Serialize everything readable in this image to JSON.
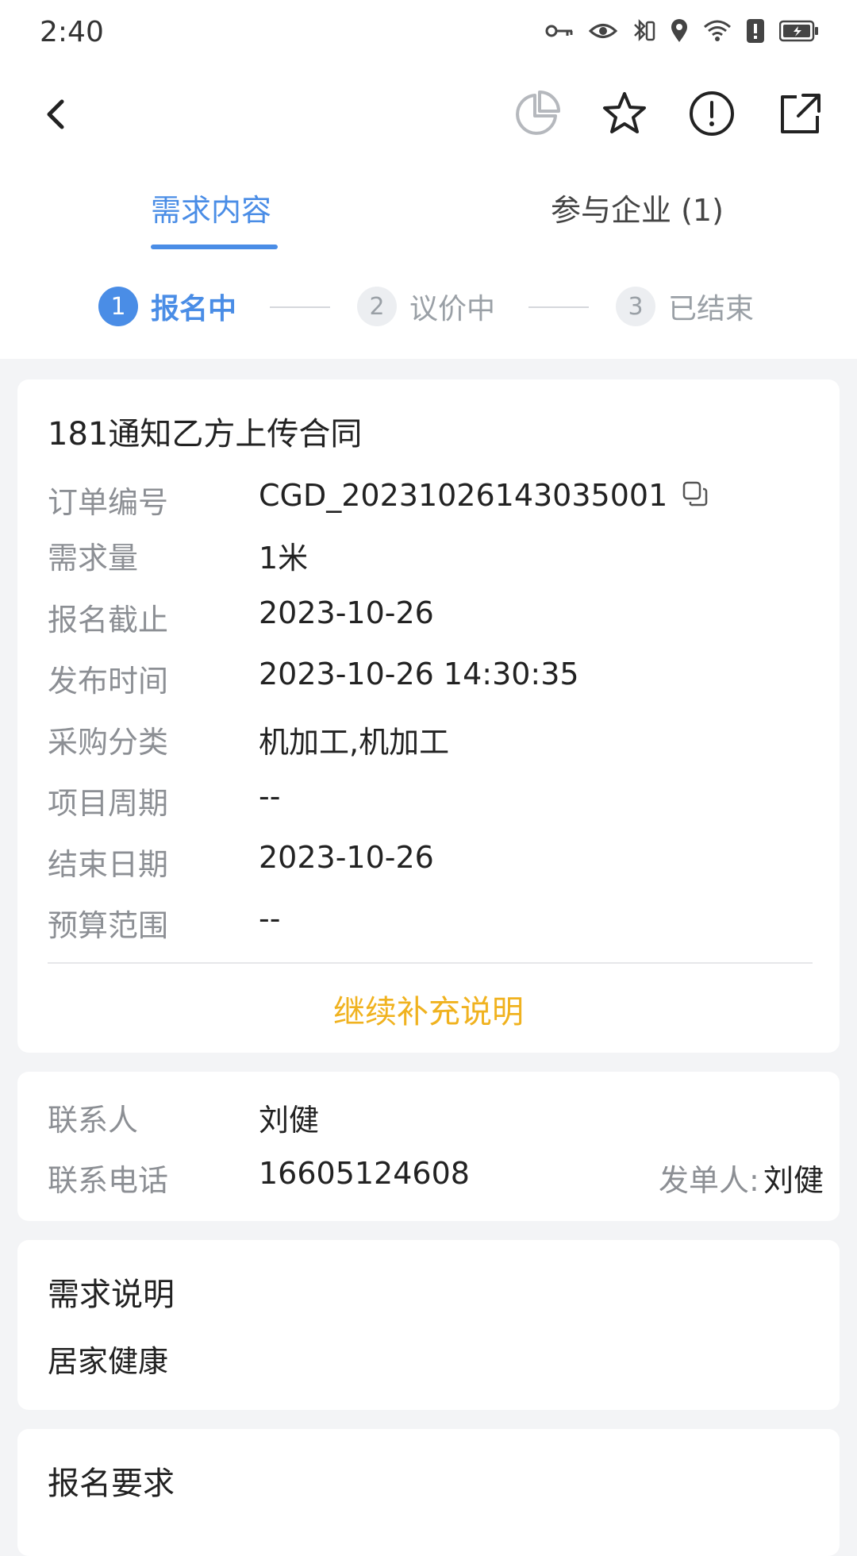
{
  "status_bar": {
    "time": "2:40",
    "icons": [
      "key-icon",
      "eye-icon",
      "bluetooth-icon",
      "location-icon",
      "wifi-icon",
      "alert-icon",
      "battery-icon"
    ]
  },
  "nav": {
    "icons": [
      "back-icon",
      "pie-chart-icon",
      "star-icon",
      "report-icon",
      "share-icon"
    ]
  },
  "tabs": [
    {
      "label": "需求内容"
    },
    {
      "label": "参与企业 (1)"
    }
  ],
  "steps": [
    {
      "num": "1",
      "label": "报名中"
    },
    {
      "num": "2",
      "label": "议价中"
    },
    {
      "num": "3",
      "label": "已结束"
    }
  ],
  "order": {
    "title": "181通知乙方上传合同",
    "rows": [
      {
        "label": "订单编号",
        "value": "CGD_20231026143035001"
      },
      {
        "label": "需求量",
        "value": "1米"
      },
      {
        "label": "报名截止",
        "value": "2023-10-26"
      },
      {
        "label": "发布时间",
        "value": "2023-10-26 14:30:35"
      },
      {
        "label": "采购分类",
        "value": "机加工,机加工"
      },
      {
        "label": "项目周期",
        "value": "--"
      },
      {
        "label": "结束日期",
        "value": "2023-10-26"
      },
      {
        "label": "预算范围",
        "value": "--"
      }
    ],
    "supplement_label": "继续补充说明"
  },
  "contact": {
    "contact_label": "联系人",
    "contact_value": "刘健",
    "phone_label": "联系电话",
    "phone_value": "16605124608",
    "issuer_label": "发单人:",
    "issuer_value": "刘健"
  },
  "description": {
    "title": "需求说明",
    "body": "居家健康"
  },
  "requirements": {
    "title": "报名要求"
  },
  "colors": {
    "accent": "#4a8de6",
    "supplement": "#f0b21f",
    "label_gray": "#8c8f94",
    "background": "#f3f4f6"
  }
}
